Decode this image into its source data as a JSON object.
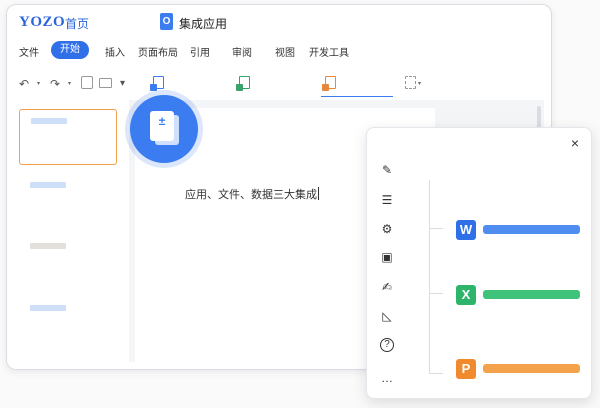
{
  "header": {
    "logo": "YOZO",
    "home_label": "首页",
    "doc_icon_glyph": "O",
    "doc_title": "集成应用"
  },
  "menu": {
    "items": [
      "文件",
      "开始",
      "插入",
      "页面布局",
      "引用",
      "审阅",
      "视图",
      "开发工具"
    ],
    "active": "开始"
  },
  "toolbar": {
    "icons": [
      "undo-icon",
      "redo-icon",
      "save-icon",
      "print-icon",
      "format-painter-icon",
      "doc-icon",
      "sheet-icon",
      "presentation-icon",
      "new-doc-icon"
    ],
    "undo_glyph": "↶",
    "redo_glyph": "↷",
    "caret_glyph": "▾"
  },
  "editor": {
    "caption": "应用、文件、数据三大集成"
  },
  "badge": {
    "glyph": "±",
    "icon": "merge-doc-icon"
  },
  "panel": {
    "close_glyph": "×",
    "side_icons": [
      {
        "name": "pen-icon",
        "glyph": "✎"
      },
      {
        "name": "list-icon",
        "glyph": "☰"
      },
      {
        "name": "sliders-icon",
        "glyph": "⚙"
      },
      {
        "name": "image-doc-icon",
        "glyph": "▣"
      },
      {
        "name": "edit-icon",
        "glyph": "✍"
      },
      {
        "name": "ruler-icon",
        "glyph": "◺"
      },
      {
        "name": "help-icon",
        "glyph": "?"
      },
      {
        "name": "more-icon",
        "glyph": "…"
      }
    ],
    "apps": [
      {
        "name": "writer",
        "glyph": "W",
        "color": "#2f6fe8",
        "bar_color": "#4f8ef0"
      },
      {
        "name": "spreadsheet",
        "glyph": "X",
        "color": "#2fb56b",
        "bar_color": "#3fc27a"
      },
      {
        "name": "presentation",
        "glyph": "P",
        "color": "#f08a2c",
        "bar_color": "#f5a24d"
      }
    ]
  },
  "colors": {
    "brand_blue": "#2f6fe8",
    "selection_orange": "#f0a04b"
  }
}
